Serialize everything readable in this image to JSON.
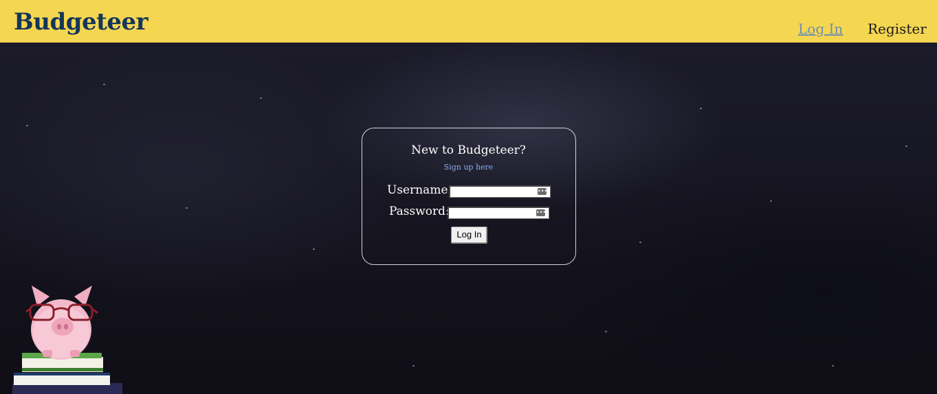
{
  "navbar": {
    "brand": "Budgeteer",
    "login_link": "Log In",
    "register_link": "Register",
    "background": "#f5d651"
  },
  "login_card": {
    "title": "New to Budgeteer?",
    "signup_link": "Sign up here",
    "username_label": "Username:",
    "username_value": "",
    "password_label": "Password:",
    "password_value": "",
    "submit_label": "Log In"
  },
  "decor": {
    "background": "chalkboard",
    "illustration": "piggy-bank-with-glasses-on-books"
  }
}
